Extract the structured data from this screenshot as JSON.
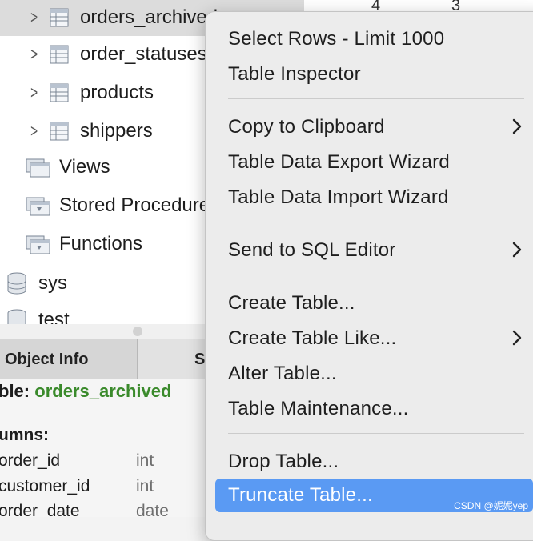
{
  "tree": {
    "items": [
      {
        "label": "orders_archived",
        "kind": "table"
      },
      {
        "label": "order_statuses",
        "kind": "table"
      },
      {
        "label": "products",
        "kind": "table"
      },
      {
        "label": "shippers",
        "kind": "table"
      },
      {
        "label": "Views",
        "kind": "folder"
      },
      {
        "label": "Stored Procedures",
        "kind": "folder"
      },
      {
        "label": "Functions",
        "kind": "folder"
      },
      {
        "label": "sys",
        "kind": "schema"
      },
      {
        "label": "test",
        "kind": "schema"
      }
    ]
  },
  "grid_top": {
    "cells": [
      "4",
      "3"
    ]
  },
  "tabs": {
    "object_info": "Object Info",
    "second": "S"
  },
  "object_info": {
    "title_prefix": "ble:",
    "table_name": "orders_archived",
    "columns_header": "umns:",
    "columns": [
      {
        "name": "order_id",
        "type": "int"
      },
      {
        "name": "customer_id",
        "type": "int"
      },
      {
        "name": "order_date",
        "type": "date"
      }
    ]
  },
  "context_menu": {
    "items": [
      {
        "label": "Select Rows - Limit 1000",
        "submenu": false
      },
      {
        "label": "Table Inspector",
        "submenu": false
      },
      {
        "label": "Copy to Clipboard",
        "submenu": true
      },
      {
        "label": "Table Data Export Wizard",
        "submenu": false
      },
      {
        "label": "Table Data Import Wizard",
        "submenu": false
      },
      {
        "label": "Send to SQL Editor",
        "submenu": true
      },
      {
        "label": "Create Table...",
        "submenu": false
      },
      {
        "label": "Create Table Like...",
        "submenu": true
      },
      {
        "label": "Alter Table...",
        "submenu": false
      },
      {
        "label": "Table Maintenance...",
        "submenu": false
      },
      {
        "label": "Drop Table...",
        "submenu": false
      },
      {
        "label": "Truncate Table...",
        "submenu": false,
        "highlighted": true
      }
    ]
  },
  "watermark": "CSDN @妮妮yep",
  "colors": {
    "highlight": "#5a9af3",
    "table_name": "#3a8a2b"
  }
}
